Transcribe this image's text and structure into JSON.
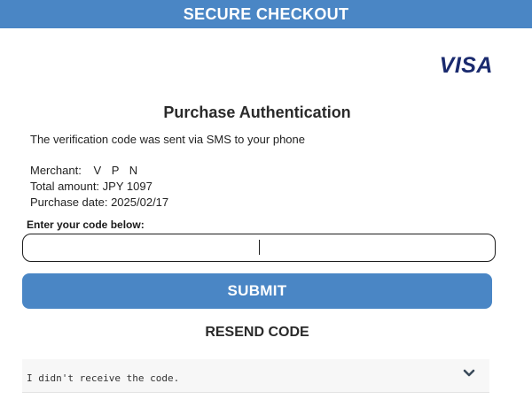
{
  "header": {
    "title": "SECURE CHECKOUT"
  },
  "brand": {
    "logo_text": "VISA",
    "color": "#1a2a6e"
  },
  "colors": {
    "accent": "#4a86c5",
    "text": "#1a1a1a"
  },
  "auth": {
    "title": "Purchase Authentication",
    "info": "The verification code was sent via SMS to your phone",
    "merchant_label": "Merchant:",
    "merchant_value": "V P N",
    "total_label": "Total amount:",
    "total_value": "JPY 1097",
    "date_label": "Purchase date:",
    "date_value": "2025/02/17"
  },
  "form": {
    "code_label": "Enter your code below:",
    "code_value": "",
    "submit_label": "SUBMIT",
    "resend_label": "RESEND CODE"
  },
  "help": {
    "accordion_label": "I didn't receive the code.",
    "icon": "chevron-down-icon"
  }
}
